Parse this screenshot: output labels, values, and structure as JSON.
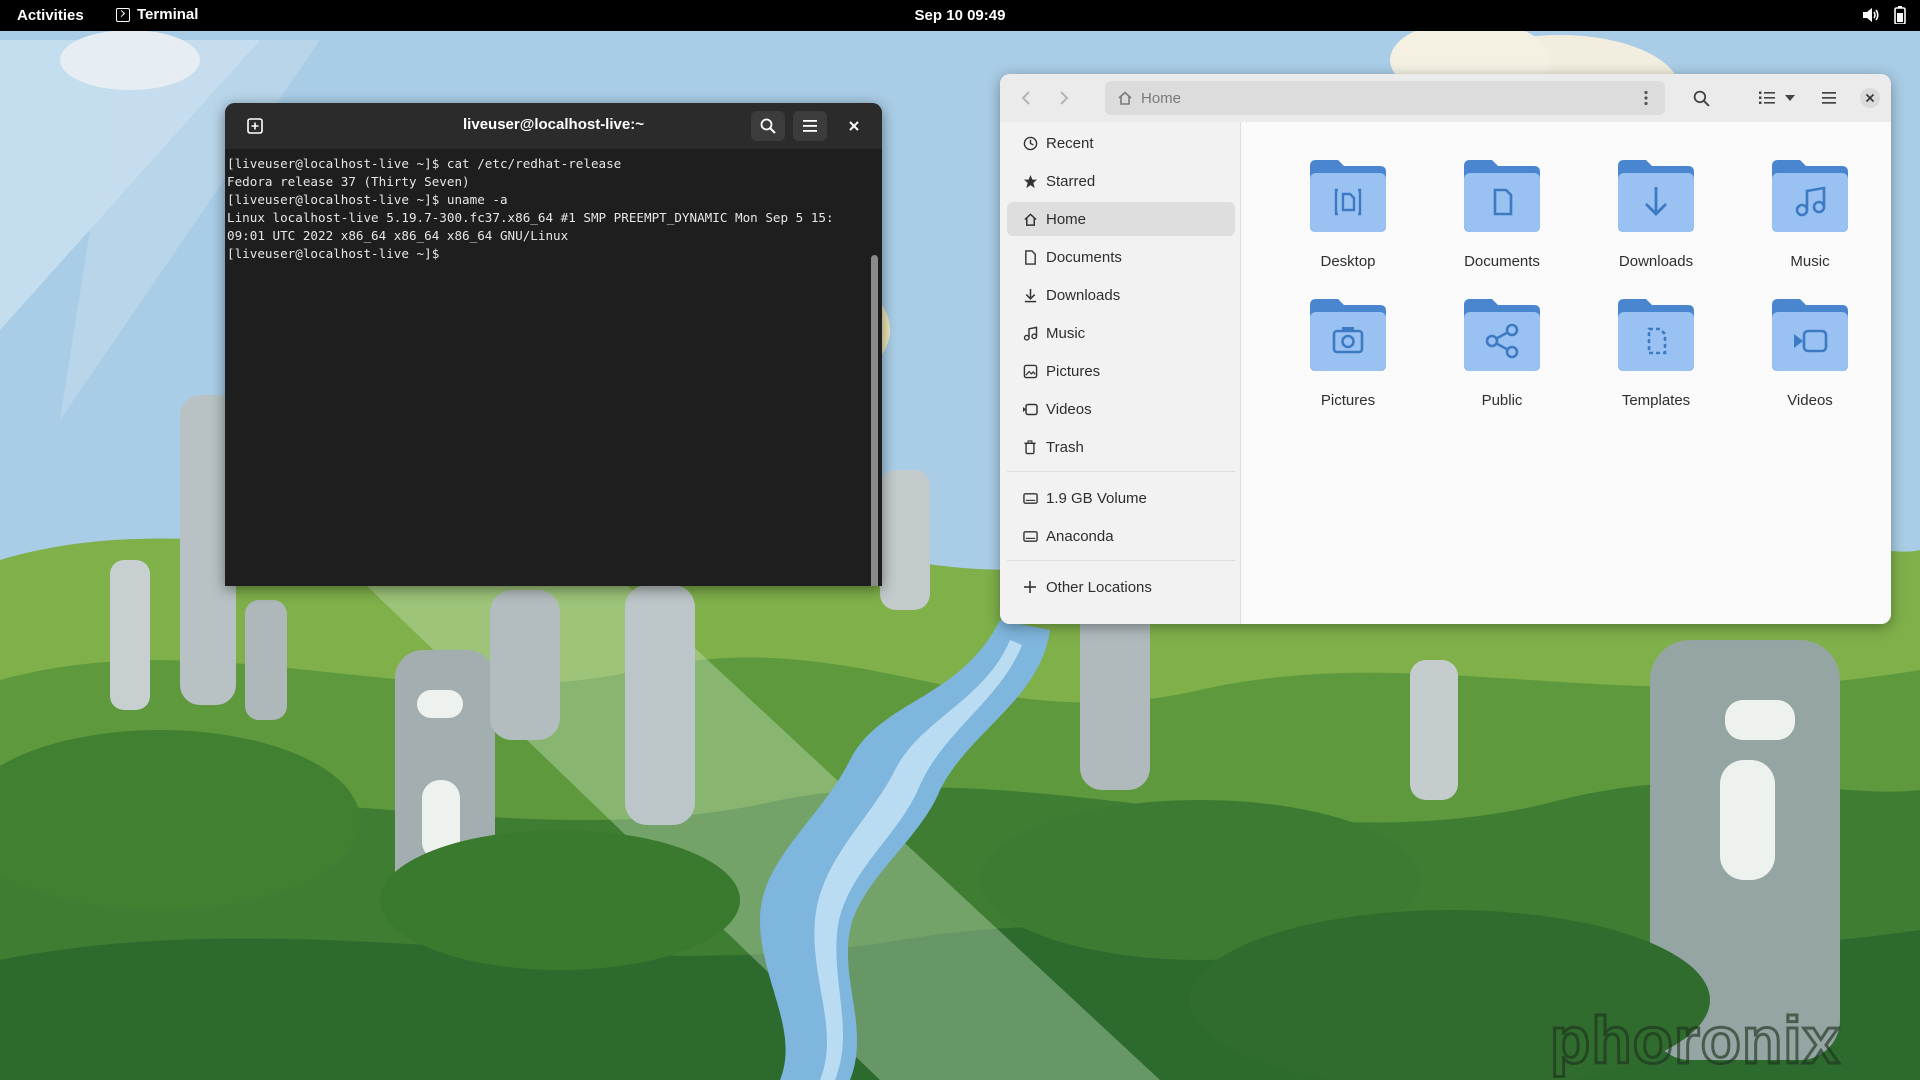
{
  "topbar": {
    "activities": "Activities",
    "app_name": "Terminal",
    "clock": "Sep 10  09:49"
  },
  "terminal": {
    "title": "liveuser@localhost-live:~",
    "lines": [
      "[liveuser@localhost-live ~]$ cat /etc/redhat-release",
      "Fedora release 37 (Thirty Seven)",
      "[liveuser@localhost-live ~]$ uname -a",
      "Linux localhost-live 5.19.7-300.fc37.x86_64 #1 SMP PREEMPT_DYNAMIC Mon Sep 5 15:",
      "09:01 UTC 2022 x86_64 x86_64 x86_64 GNU/Linux",
      "[liveuser@localhost-live ~]$ "
    ]
  },
  "files": {
    "path": "Home",
    "sidebar": {
      "places": [
        "Recent",
        "Starred",
        "Home",
        "Documents",
        "Downloads",
        "Music",
        "Pictures",
        "Videos",
        "Trash"
      ],
      "devices": [
        "1.9 GB Volume",
        "Anaconda"
      ],
      "other": "Other Locations"
    },
    "folders": [
      "Desktop",
      "Documents",
      "Downloads",
      "Music",
      "Pictures",
      "Public",
      "Templates",
      "Videos"
    ]
  },
  "watermark": "phoronix",
  "colors": {
    "folder_back": "#4a86cf",
    "folder_front": "#99c1f1",
    "terminal_bg": "#1e1e1e",
    "topbar_bg": "#000000"
  }
}
